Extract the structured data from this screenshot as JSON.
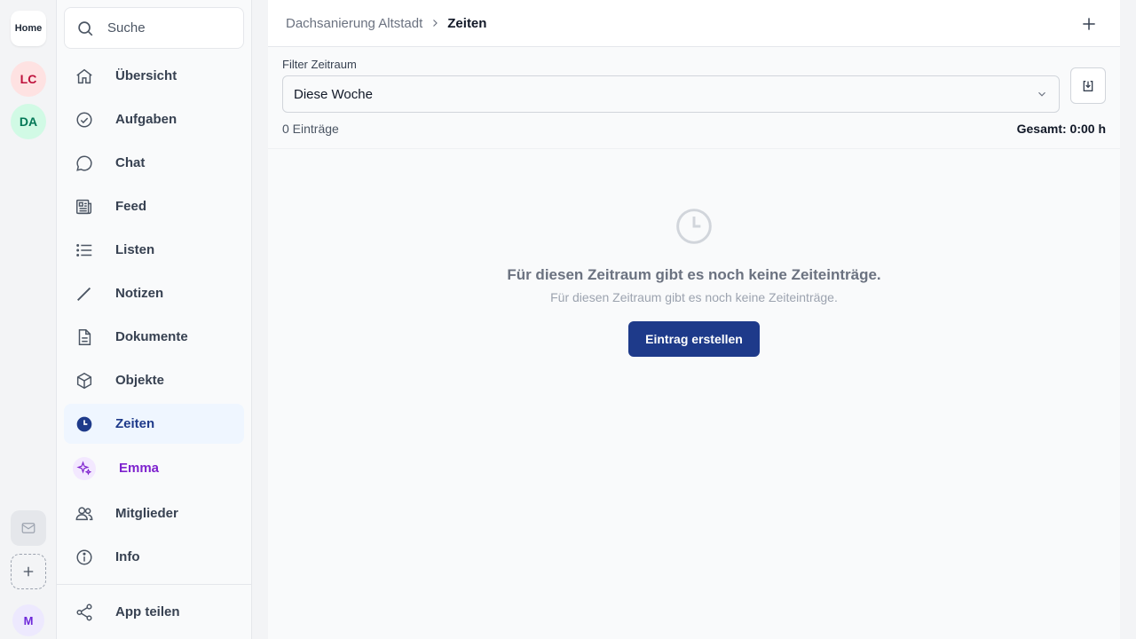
{
  "rail": {
    "home_label": "Home",
    "workspaces": [
      {
        "initials": "LC",
        "color": "#be123c",
        "bg": "#fee2e2"
      },
      {
        "initials": "DA",
        "color": "#047857",
        "bg": "#d1fae5"
      }
    ],
    "mail_icon": "mail-icon",
    "add_icon": "plus-icon",
    "user_initial": "M"
  },
  "sidebar": {
    "search": {
      "placeholder": "Suche",
      "icon": "search-icon"
    },
    "items": [
      {
        "label": "Übersicht",
        "icon": "home-icon"
      },
      {
        "label": "Aufgaben",
        "icon": "check-circle-icon"
      },
      {
        "label": "Chat",
        "icon": "chat-bubble-icon"
      },
      {
        "label": "Feed",
        "icon": "newspaper-icon"
      },
      {
        "label": "Listen",
        "icon": "list-icon"
      },
      {
        "label": "Notizen",
        "icon": "pencil-icon"
      },
      {
        "label": "Dokumente",
        "icon": "document-icon"
      },
      {
        "label": "Objekte",
        "icon": "cube-icon"
      },
      {
        "label": "Zeiten",
        "icon": "clock-icon",
        "active": true
      },
      {
        "label": "Emma",
        "icon": "sparkles-icon"
      },
      {
        "label": "Mitglieder",
        "icon": "users-icon"
      },
      {
        "label": "Info",
        "icon": "info-icon"
      },
      {
        "label": "App teilen",
        "icon": "share-icon"
      }
    ]
  },
  "header": {
    "breadcrumb_parent": "Dachsanierung Altstadt",
    "breadcrumb_current": "Zeiten",
    "add_icon": "plus-icon"
  },
  "filter": {
    "label": "Filter Zeitraum",
    "selected": "Diese Woche",
    "export_icon": "download-icon"
  },
  "summary": {
    "count": "0 Einträge",
    "total": "Gesamt: 0:00 h"
  },
  "empty_state": {
    "icon": "clock-icon",
    "title": "Für diesen Zeitraum gibt es noch keine Zeiteinträge.",
    "subtitle": "Für diesen Zeitraum gibt es noch keine Zeiteinträge.",
    "button_label": "Eintrag erstellen"
  },
  "colors": {
    "accent": "#1e3a8a",
    "active_bg": "#eff6ff",
    "emma": "#7e22ce"
  }
}
